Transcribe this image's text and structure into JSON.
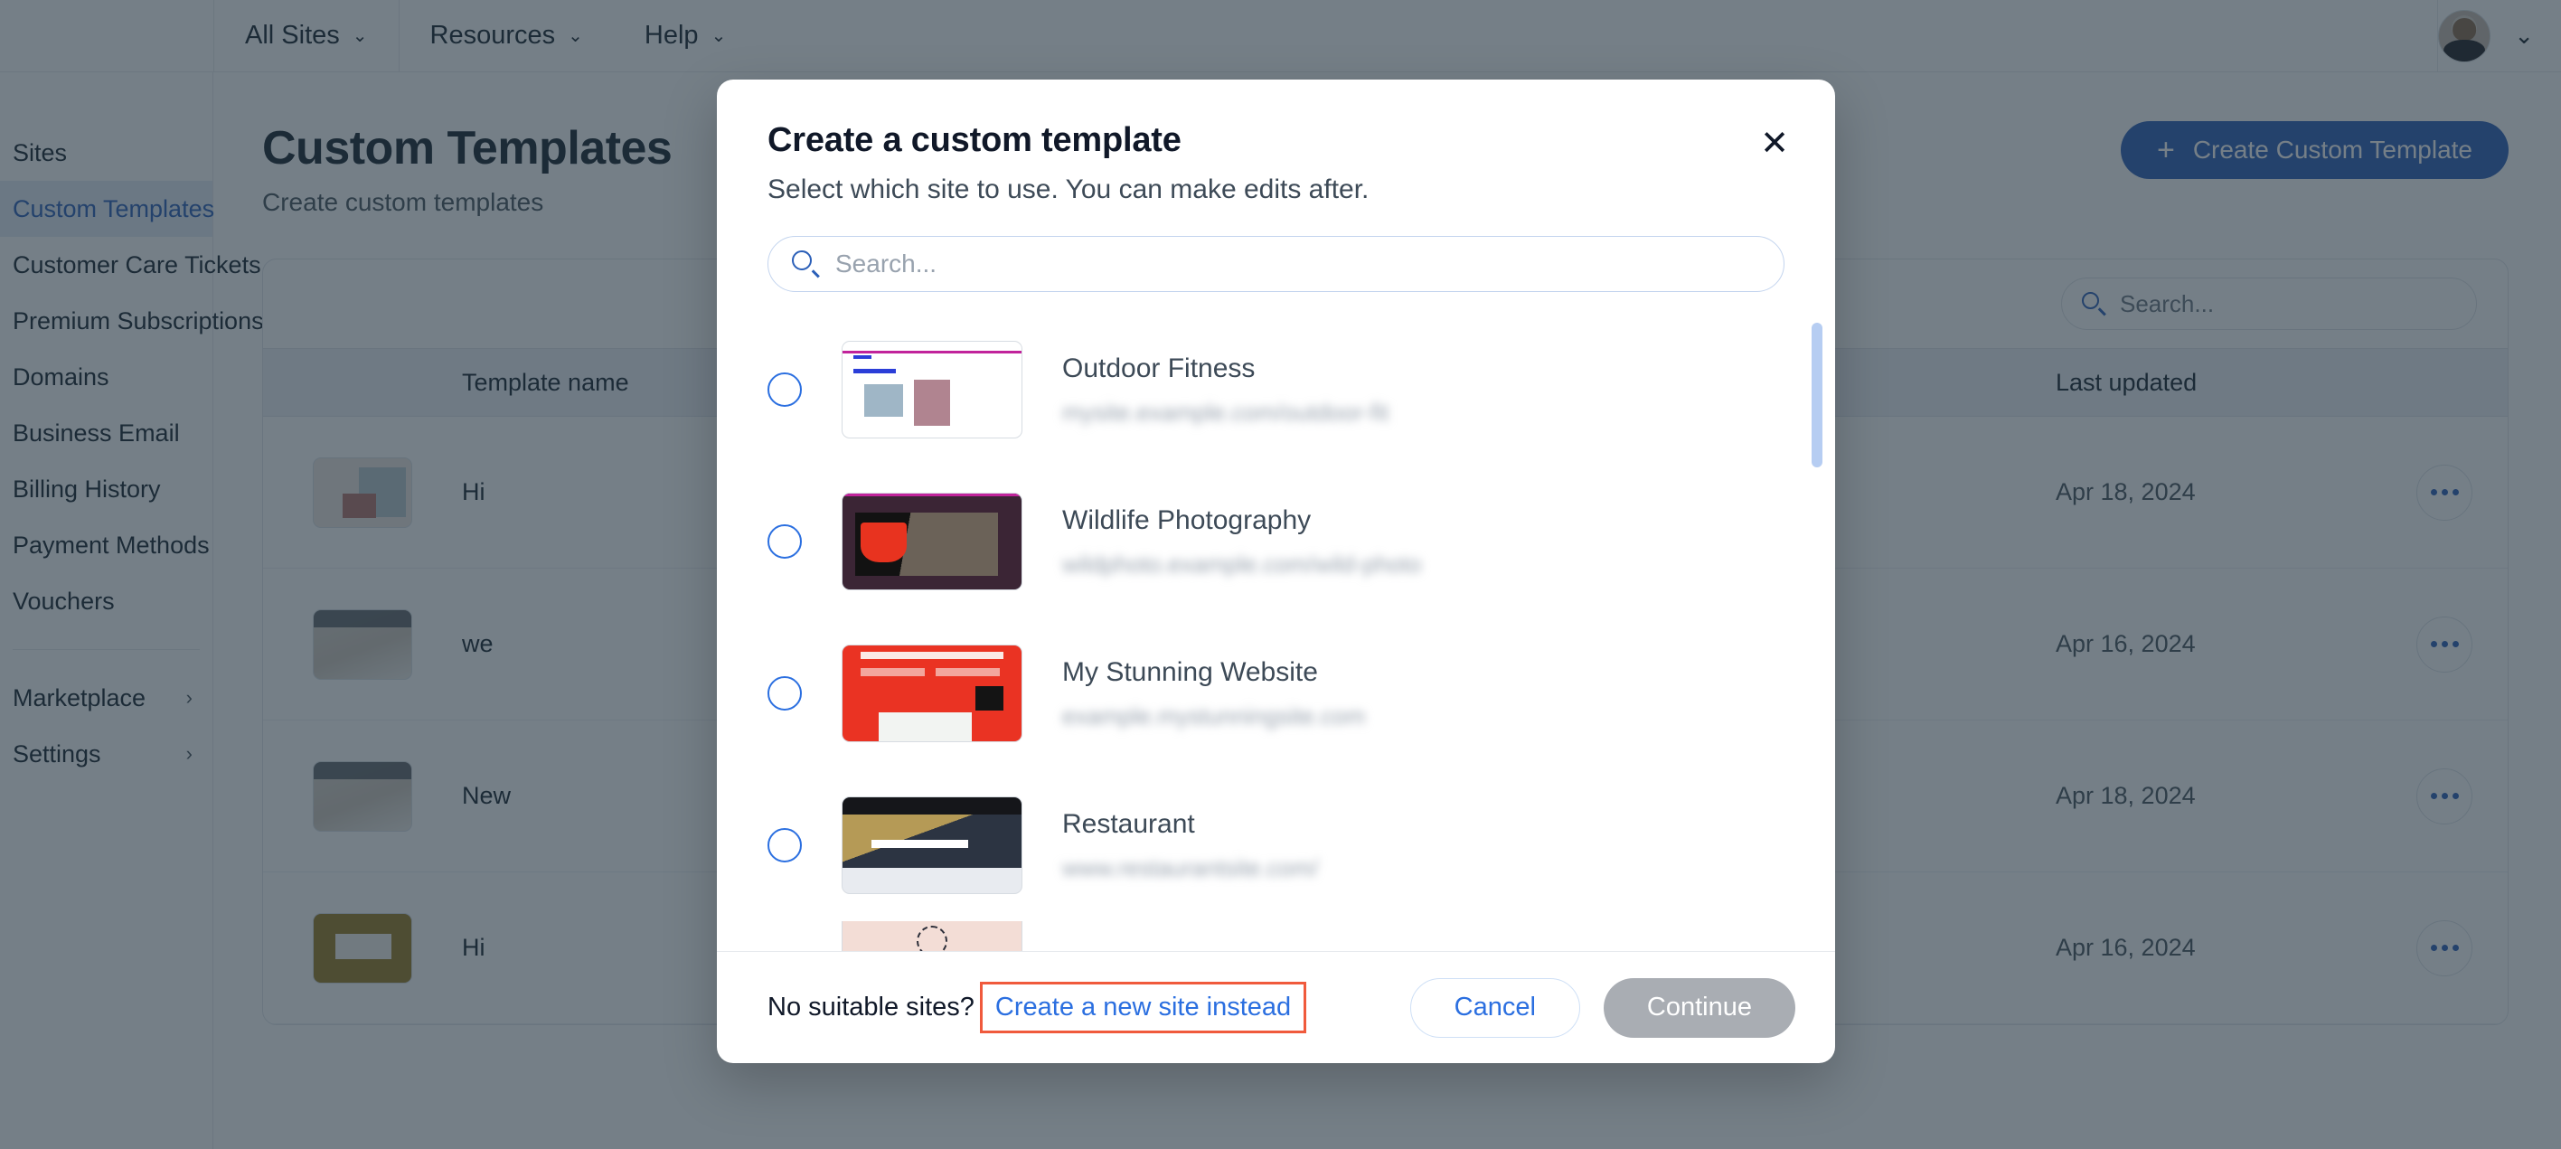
{
  "topbar": {
    "nav": [
      {
        "label": "All Sites",
        "icon": "chevron-down-icon"
      },
      {
        "label": "Resources",
        "icon": "chevron-down-icon"
      },
      {
        "label": "Help",
        "icon": "chevron-down-icon"
      }
    ],
    "account_chevron": "⌄"
  },
  "sidebar": {
    "items": [
      {
        "label": "Sites",
        "active": false,
        "arrow": ""
      },
      {
        "label": "Custom Templates",
        "active": true,
        "arrow": ""
      },
      {
        "label": "Customer Care Tickets",
        "active": false,
        "arrow": ""
      },
      {
        "label": "Premium Subscriptions",
        "active": false,
        "arrow": ""
      },
      {
        "label": "Domains",
        "active": false,
        "arrow": ""
      },
      {
        "label": "Business Email",
        "active": false,
        "arrow": ""
      },
      {
        "label": "Billing History",
        "active": false,
        "arrow": ""
      },
      {
        "label": "Payment Methods",
        "active": false,
        "arrow": ""
      },
      {
        "label": "Vouchers",
        "active": false,
        "arrow": ""
      }
    ],
    "items_bottom": [
      {
        "label": "Marketplace",
        "arrow": "›"
      },
      {
        "label": "Settings",
        "arrow": "›"
      }
    ]
  },
  "page": {
    "title": "Custom Templates",
    "subtitle": "Create custom templates",
    "create_button": "Create Custom Template",
    "create_button_icon": "plus-icon",
    "search_placeholder": "Search...",
    "table": {
      "columns": [
        "",
        "Template name",
        "Last updated",
        ""
      ],
      "rows": [
        {
          "name": "Hi",
          "updated": "Apr 18, 2024",
          "art": "art-pop"
        },
        {
          "name": "we",
          "updated": "Apr 16, 2024",
          "art": "art-cream"
        },
        {
          "name": "New",
          "updated": "Apr 18, 2024",
          "art": "art-cream"
        },
        {
          "name": "Hi",
          "updated": "Apr 16, 2024",
          "art": "art-gold"
        }
      ]
    }
  },
  "modal": {
    "title": "Create a custom template",
    "subtitle": "Select which site to use. You can make edits after.",
    "close_icon": "✕",
    "search_placeholder": "Search...",
    "search_icon": "search-icon",
    "sites": [
      {
        "name": "Outdoor Fitness",
        "url": "mysite.example.com/outdoor-fit",
        "thumb": "s-outdoor"
      },
      {
        "name": "Wildlife Photography",
        "url": "wildphoto.example.com/wild-photo",
        "thumb": "s-wildlife"
      },
      {
        "name": "My Stunning Website",
        "url": "example.mystunningsite.com",
        "thumb": "s-stunning"
      },
      {
        "name": "Restaurant",
        "url": "www.restaurantsite.com/",
        "thumb": "s-restaurant"
      }
    ],
    "footer": {
      "question": "No suitable sites?",
      "link": "Create a new site instead",
      "cancel": "Cancel",
      "continue": "Continue"
    }
  },
  "colors": {
    "accent_blue": "#2b5fb8",
    "link_blue": "#2b6fe0",
    "highlight_red": "#f05a3c",
    "overlay": "#20303d",
    "scrollbar": "#b6cdf2",
    "disabled_gray": "#a9adb3"
  }
}
